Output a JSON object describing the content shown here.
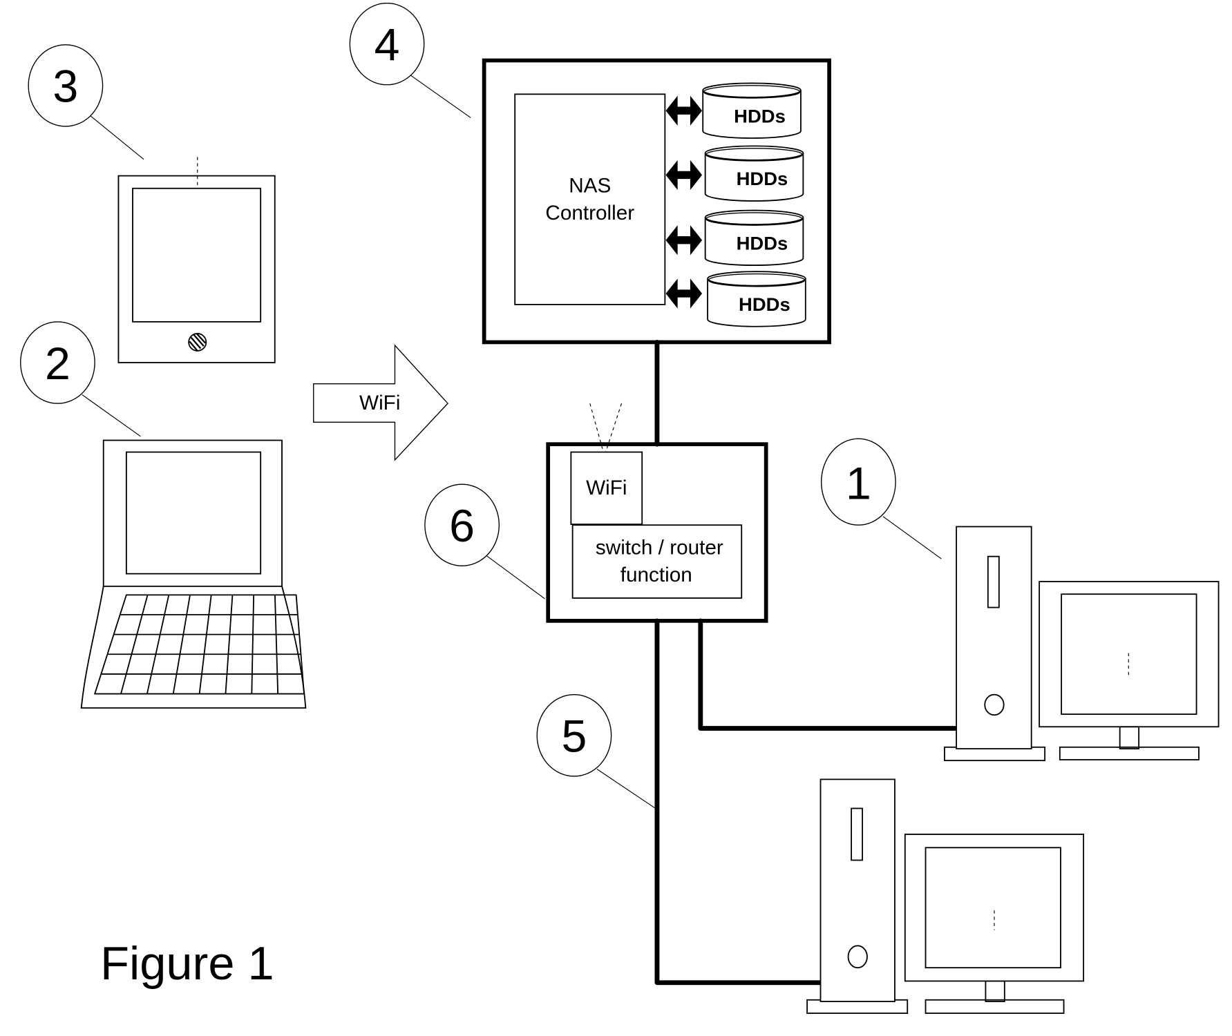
{
  "figure": {
    "caption": "Figure 1",
    "callouts": {
      "c1": "1",
      "c2": "2",
      "c3": "3",
      "c4": "4",
      "c5": "5",
      "c6": "6"
    },
    "nas": {
      "controller_line1": "NAS",
      "controller_line2": "Controller",
      "drives": [
        "HDDs",
        "HDDs",
        "HDDs",
        "HDDs"
      ]
    },
    "wifi_arrow_label": "WiFi",
    "router": {
      "wifi_label": "WiFi",
      "function_line1": "switch / router",
      "function_line2": "function"
    },
    "devices": {
      "tablet": "tablet",
      "laptop": "laptop",
      "desktop_1": "desktop computer",
      "desktop_2": "desktop computer"
    }
  }
}
